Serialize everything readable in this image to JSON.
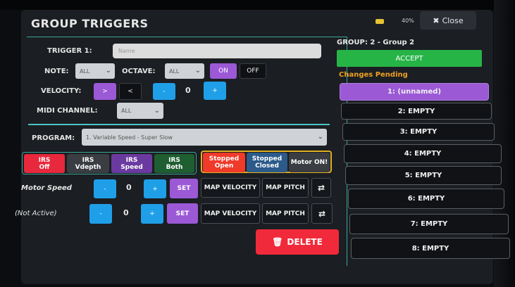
{
  "header": {
    "title": "GROUP TRIGGERS",
    "battery": "40%",
    "close_label": "Close"
  },
  "trigger": {
    "label": "TRIGGER 1:",
    "placeholder": "Name"
  },
  "note": {
    "label": "NOTE:",
    "value": "ALL"
  },
  "octave": {
    "label": "OCTAVE:",
    "value": "ALL",
    "on_label": "ON",
    "off_label": "OFF"
  },
  "velocity": {
    "label": "VELOCITY:",
    "gt": ">",
    "lt": "<",
    "minus": "-",
    "value": "0",
    "plus": "+"
  },
  "midi": {
    "label": "MIDI CHANNEL:",
    "value": "ALL"
  },
  "program": {
    "label": "PROGRAM:",
    "value": "1. Variable Speed - Super Slow"
  },
  "irs": [
    {
      "label": "IRS\nOff",
      "color": "#e8283c"
    },
    {
      "label": "IRS\nVdepth",
      "color": "#3a3d42"
    },
    {
      "label": "IRS\nSpeed",
      "color": "#6b3aa0"
    },
    {
      "label": "IRS\nBoth",
      "color": "#1f5e30"
    }
  ],
  "motor_states": [
    {
      "label": "Stopped\nOpen",
      "color": "#f03a2a"
    },
    {
      "label": "Stopped\nClosed",
      "color": "#2c5a8a"
    },
    {
      "label": "Motor ON!",
      "color": "#3a3d42"
    }
  ],
  "motor_speed": {
    "label": "Motor Speed",
    "minus": "-",
    "value": "0",
    "plus": "+",
    "set_label": "SET",
    "map_velocity": "MAP VELOCITY",
    "map_pitch": "MAP PITCH"
  },
  "not_active": {
    "label": "(Not Active)",
    "minus": "-",
    "value": "0",
    "plus": "+",
    "set_label": "SET",
    "map_velocity": "MAP VELOCITY",
    "map_pitch": "MAP PITCH"
  },
  "delete_label": "DELETE",
  "group": {
    "title": "GROUP: 2 - Group 2",
    "accept_label": "ACCEPT",
    "pending_label": "Changes Pending",
    "slots": [
      "1: (unnamed)",
      "2: EMPTY",
      "3: EMPTY",
      "4: EMPTY",
      "5: EMPTY",
      "6: EMPTY",
      "7: EMPTY",
      "8: EMPTY"
    ]
  },
  "colors": {
    "accent": "#9b59d6",
    "accept": "#27b447",
    "delete": "#f02a3a",
    "blue": "#1f9fe8",
    "pending": "#f0a020"
  }
}
